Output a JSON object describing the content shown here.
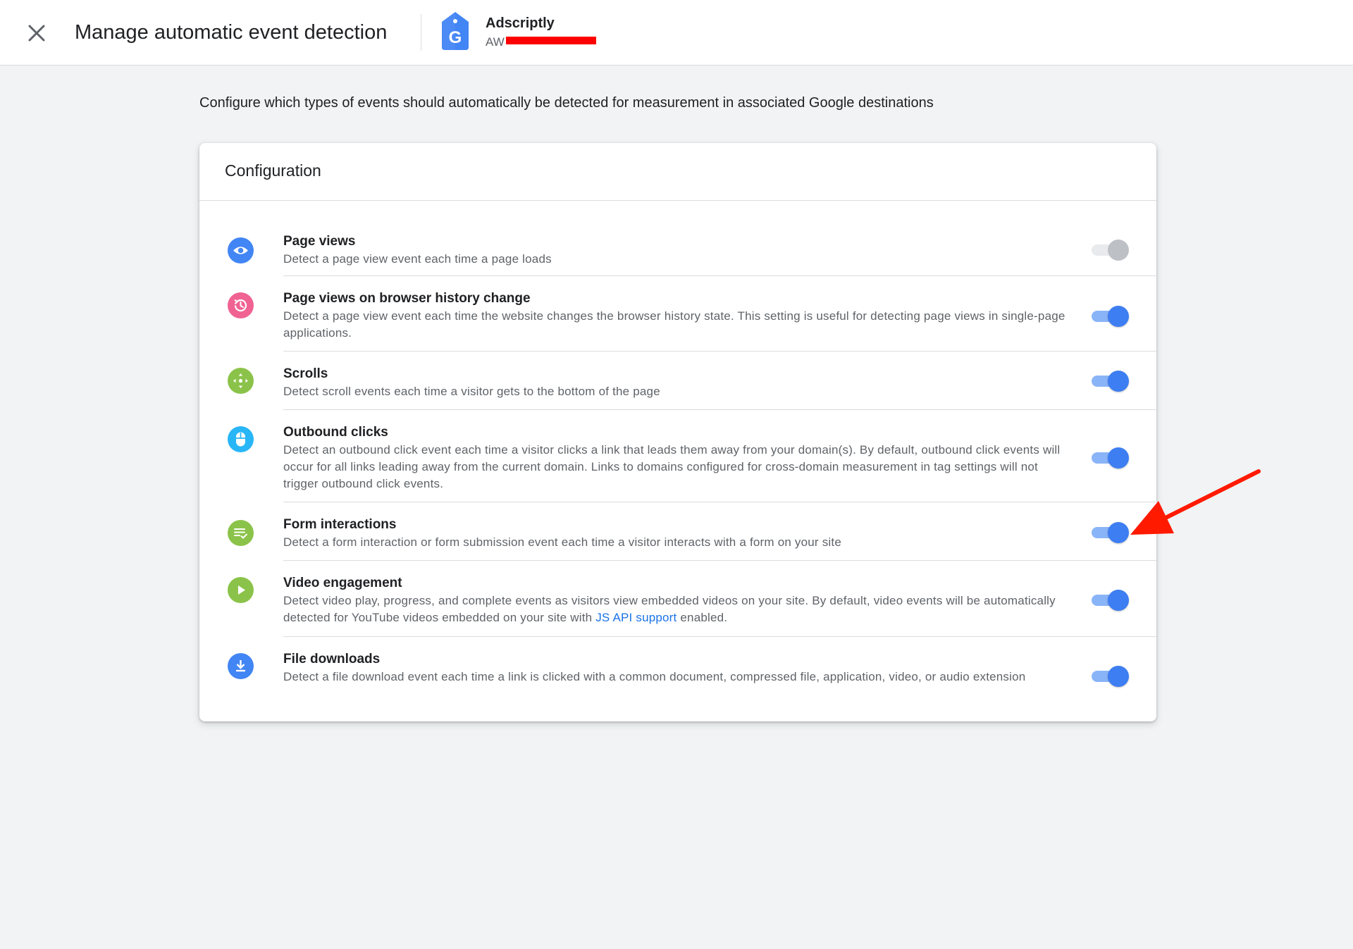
{
  "header": {
    "title": "Manage automatic event detection",
    "account_name": "Adscriptly",
    "account_id": "AW"
  },
  "intro": "Configure which types of events should automatically be detected for measurement in associated Google destinations",
  "card": {
    "title": "Configuration",
    "items": [
      {
        "icon": "eye-icon",
        "color": "#4285f4",
        "title": "Page views",
        "desc": "Detect a page view event each time a page loads",
        "enabled": true,
        "disabled": true
      },
      {
        "icon": "history-icon",
        "color": "#f06292",
        "title": "Page views on browser history change",
        "desc": "Detect a page view event each time the website changes the browser history state. This setting is useful for detecting page views in single-page applications.",
        "enabled": true
      },
      {
        "icon": "scroll-move-icon",
        "color": "#8bc34a",
        "title": "Scrolls",
        "desc": "Detect scroll events each time a visitor gets to the bottom of the page",
        "enabled": true
      },
      {
        "icon": "mouse-icon",
        "color": "#29b6f6",
        "title": "Outbound clicks",
        "desc": "Detect an outbound click event each time a visitor clicks a link that leads them away from your domain(s). By default, outbound click events will occur for all links leading away from the current domain. Links to domains configured for cross-domain measurement in tag settings will not trigger outbound click events.",
        "enabled": true
      },
      {
        "icon": "form-check-icon",
        "color": "#8bc34a",
        "title": "Form interactions",
        "desc": "Detect a form interaction or form submission event each time a visitor interacts with a form on your site",
        "enabled": true
      },
      {
        "icon": "play-icon",
        "color": "#8bc34a",
        "title": "Video engagement",
        "desc_before": "Detect video play, progress, and complete events as visitors view embedded videos on your site. By default, video events will be automatically detected for YouTube videos embedded on your site with ",
        "link": "JS API support",
        "desc_after": " enabled.",
        "enabled": true
      },
      {
        "icon": "download-icon",
        "color": "#4285f4",
        "title": "File downloads",
        "desc": "Detect a file download event each time a link is clicked with a common document, compressed file, application, video, or audio extension",
        "enabled": true
      }
    ]
  },
  "colors": {
    "accent": "#3d7ef2",
    "arrow": "#ff1a00"
  }
}
